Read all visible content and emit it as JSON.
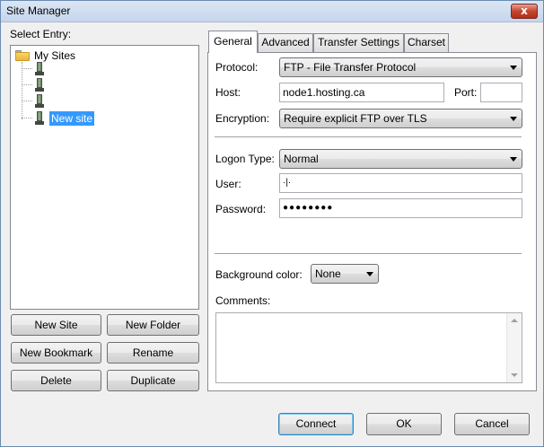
{
  "window": {
    "title": "Site Manager",
    "close_glyph": "x"
  },
  "left": {
    "select_entry_label": "Select Entry:",
    "tree": {
      "root_label": "My Sites",
      "sites": [
        {
          "label": "",
          "icon": "server-icon"
        },
        {
          "label": "",
          "icon": "server-icon"
        },
        {
          "label": "",
          "icon": "server-icon"
        },
        {
          "label": "New site",
          "icon": "server-icon",
          "selected": true
        }
      ]
    },
    "buttons": {
      "new_site": "New Site",
      "new_folder": "New Folder",
      "new_bookmark": "New Bookmark",
      "rename": "Rename",
      "delete": "Delete",
      "duplicate": "Duplicate"
    }
  },
  "tabs": [
    "General",
    "Advanced",
    "Transfer Settings",
    "Charset"
  ],
  "general": {
    "protocol_label": "Protocol:",
    "protocol_value": "FTP - File Transfer Protocol",
    "host_label": "Host:",
    "host_value": "node1.hosting.ca",
    "port_label": "Port:",
    "port_value": "",
    "encryption_label": "Encryption:",
    "encryption_value": "Require explicit FTP over TLS",
    "logon_type_label": "Logon Type:",
    "logon_type_value": "Normal",
    "user_label": "User:",
    "user_value": "·|·",
    "password_label": "Password:",
    "password_value": "●●●●●●●●",
    "background_color_label": "Background color:",
    "background_color_value": "None",
    "comments_label": "Comments:",
    "comments_value": ""
  },
  "footer": {
    "connect": "Connect",
    "ok": "OK",
    "cancel": "Cancel"
  }
}
